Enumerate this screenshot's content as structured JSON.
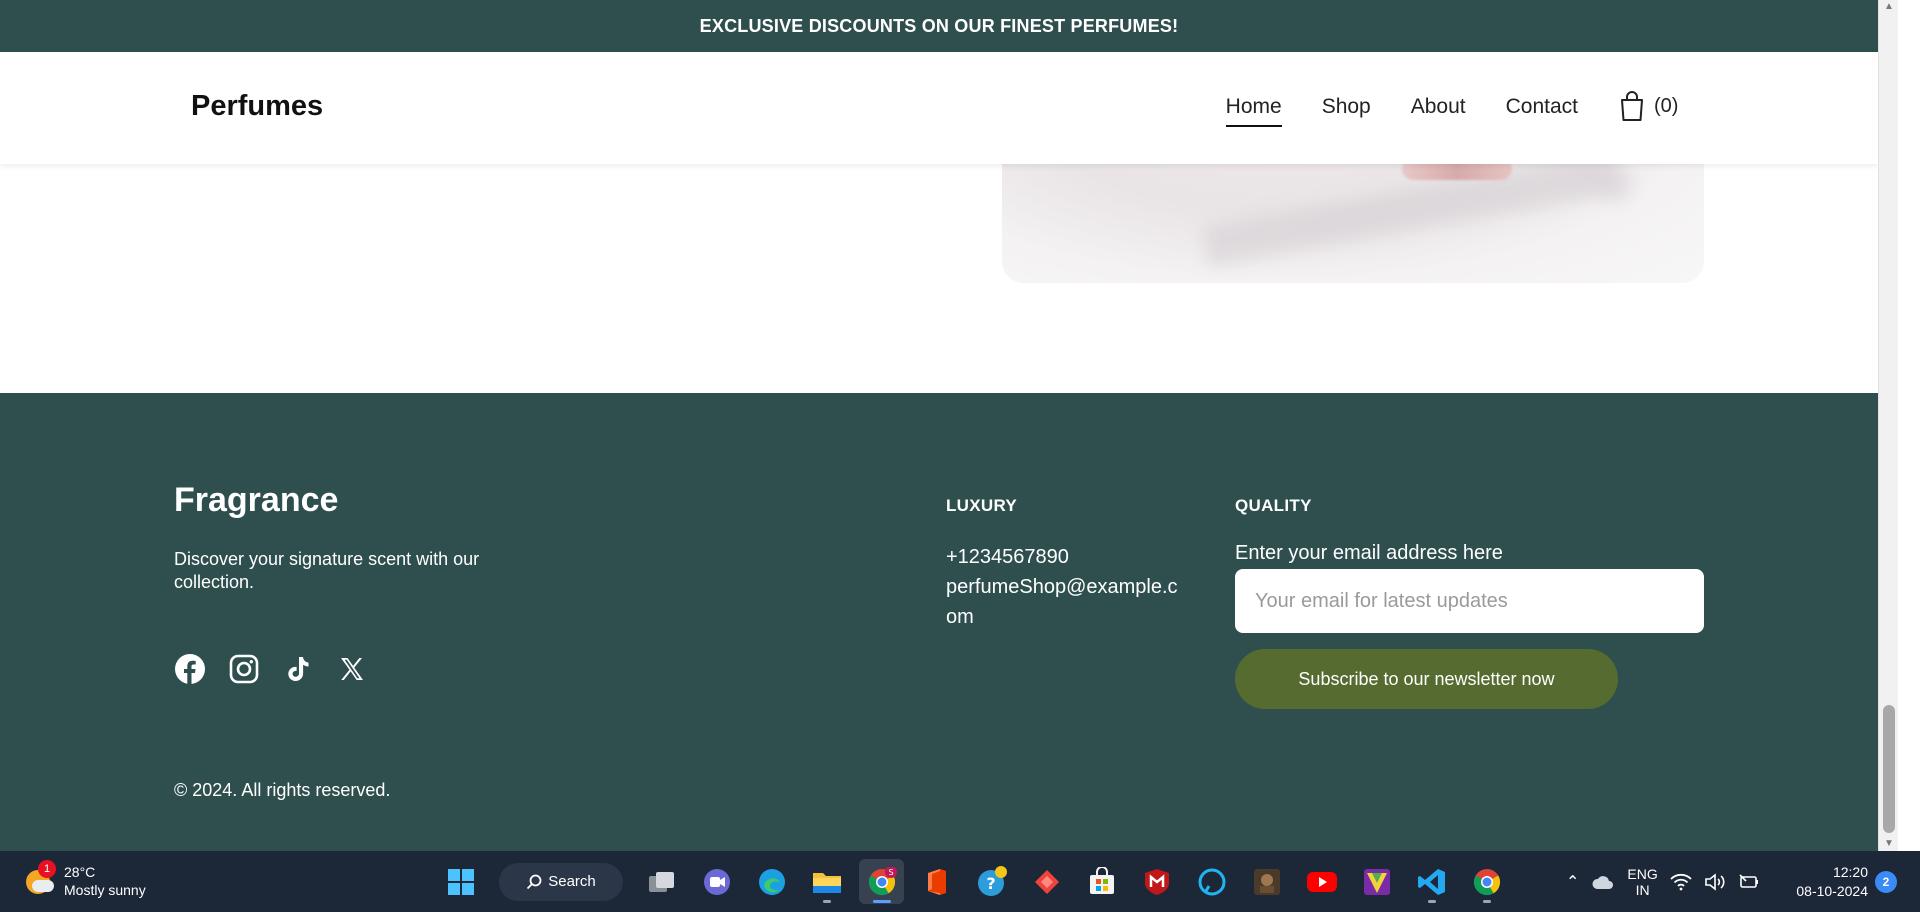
{
  "promo": {
    "text": "EXCLUSIVE DISCOUNTS ON OUR FINEST PERFUMES!"
  },
  "navbar": {
    "brand": "Perfumes",
    "links": [
      "Home",
      "Shop",
      "About",
      "Contact"
    ],
    "active_link": "Home",
    "cart_count": "(0)"
  },
  "footer": {
    "title": "Fragrance",
    "description": "Discover your signature scent with our collection.",
    "socials": [
      "facebook-icon",
      "instagram-icon",
      "tiktok-icon",
      "x-icon"
    ],
    "copyright": "© 2024. All rights reserved.",
    "luxury": {
      "heading": "LUXURY",
      "phone": "+1234567890",
      "email": "perfumeShop@example.com"
    },
    "quality": {
      "heading": "QUALITY",
      "email_label": "Enter your email address here",
      "email_placeholder": "Your email for latest updates",
      "subscribe_label": "Subscribe to our newsletter now"
    }
  },
  "taskbar": {
    "weather": {
      "temp": "28°C",
      "condition": "Mostly sunny",
      "badge": "1"
    },
    "search_label": "Search",
    "language": {
      "line1": "ENG",
      "line2": "IN"
    },
    "time": "12:20",
    "date": "08-10-2024",
    "notifications": "2"
  },
  "colors": {
    "primary_dark": "#2f4f4f",
    "button_olive": "#556b2f",
    "taskbar": "#1c2738"
  }
}
